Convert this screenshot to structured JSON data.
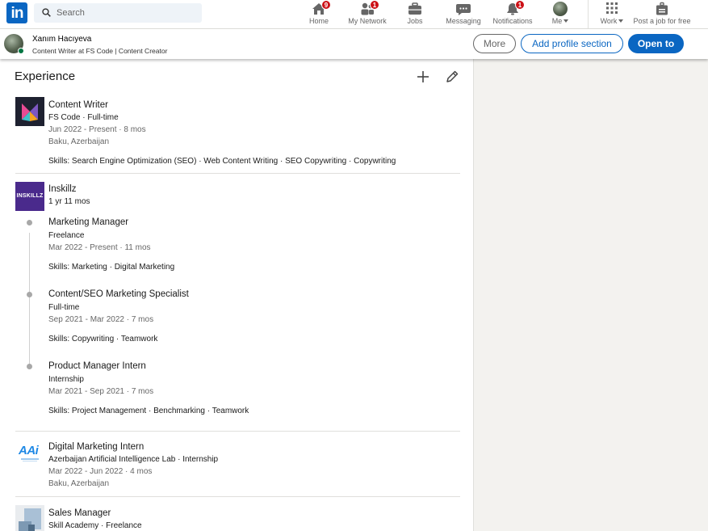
{
  "nav": {
    "logo_text": "in",
    "search_placeholder": "Search",
    "items": [
      {
        "label": "Home",
        "badge": "9"
      },
      {
        "label": "My Network",
        "badge": "1"
      },
      {
        "label": "Jobs"
      },
      {
        "label": "Messaging"
      },
      {
        "label": "Notifications",
        "badge": "1"
      },
      {
        "label": "Me"
      },
      {
        "label": "Work"
      },
      {
        "label": "Post a job for free"
      }
    ]
  },
  "profile": {
    "name": "Xanım Hacıyeva",
    "headline": "Content Writer at FS Code | Content Creator",
    "buttons": {
      "more": "More",
      "add_section": "Add profile section",
      "open_to": "Open to"
    }
  },
  "section": {
    "title": "Experience"
  },
  "experiences": [
    {
      "title": "Content Writer",
      "company": "FS Code · Full-time",
      "dates": "Jun 2022 - Present · 8 mos",
      "location": "Baku, Azerbaijan",
      "skills_label": "Skills:",
      "skills": "Search Engine Optimization (SEO) · Web Content Writing · SEO Copywriting · Copywriting"
    },
    {
      "company": "Inskillz",
      "logo_text": "INSKILLZ",
      "duration": "1 yr 11 mos",
      "roles": [
        {
          "title": "Marketing Manager",
          "type": "Freelance",
          "dates": "Mar 2022 - Present · 11 mos",
          "skills_label": "Skills:",
          "skills": "Marketing · Digital Marketing"
        },
        {
          "title": "Content/SEO Marketing Specialist",
          "type": "Full-time",
          "dates": "Sep 2021 - Mar 2022 · 7 mos",
          "skills_label": "Skills:",
          "skills": "Copywriting · Teamwork"
        },
        {
          "title": "Product Manager Intern",
          "type": "Internship",
          "dates": "Mar 2021 - Sep 2021 · 7 mos",
          "skills_label": "Skills:",
          "skills": "Project Management · Benchmarking · Teamwork"
        }
      ]
    },
    {
      "title": "Digital Marketing Intern",
      "logo_text": "AAi",
      "company": "Azerbaijan Artificial Intelligence Lab · Internship",
      "dates": "Mar 2022 - Jun 2022 · 4 mos",
      "location": "Baku, Azerbaijan"
    },
    {
      "title": "Sales Manager",
      "company": "Skill Academy · Freelance"
    }
  ],
  "colors": {
    "brand": "#0a66c2",
    "badge": "#cc1016",
    "online": "#057642"
  }
}
